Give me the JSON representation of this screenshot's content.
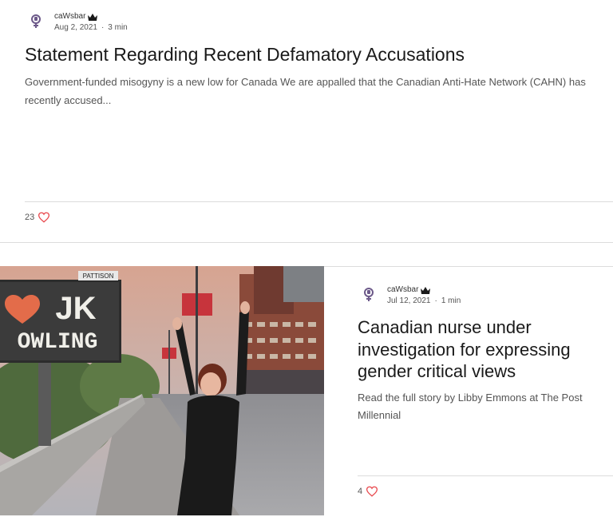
{
  "posts": [
    {
      "author": "caWsbar",
      "date": "Aug 2, 2021",
      "read_time": "3 min",
      "title": "Statement Regarding Recent Defamatory Accusations",
      "excerpt": "Government-funded misogyny is a new low for Canada We are appalled that the Canadian Anti-Hate Network (CAHN) has recently accused...",
      "likes": "23"
    },
    {
      "author": "caWsbar",
      "date": "Jul 12, 2021",
      "read_time": "1 min",
      "title": "Canadian nurse under investigation for expressing gender critical views",
      "excerpt": "Read the full story by Libby Emmons at The Post Millennial",
      "likes": "4",
      "image": {
        "billboard_top": "PATTISON",
        "billboard_line1": "JK",
        "billboard_line2": "OWLING"
      }
    }
  ],
  "colors": {
    "heart": "#e8454a",
    "accent_avatar": "#6d5a8a"
  },
  "icons": [
    "venus-fist-avatar-icon",
    "crown-icon",
    "heart-icon"
  ]
}
